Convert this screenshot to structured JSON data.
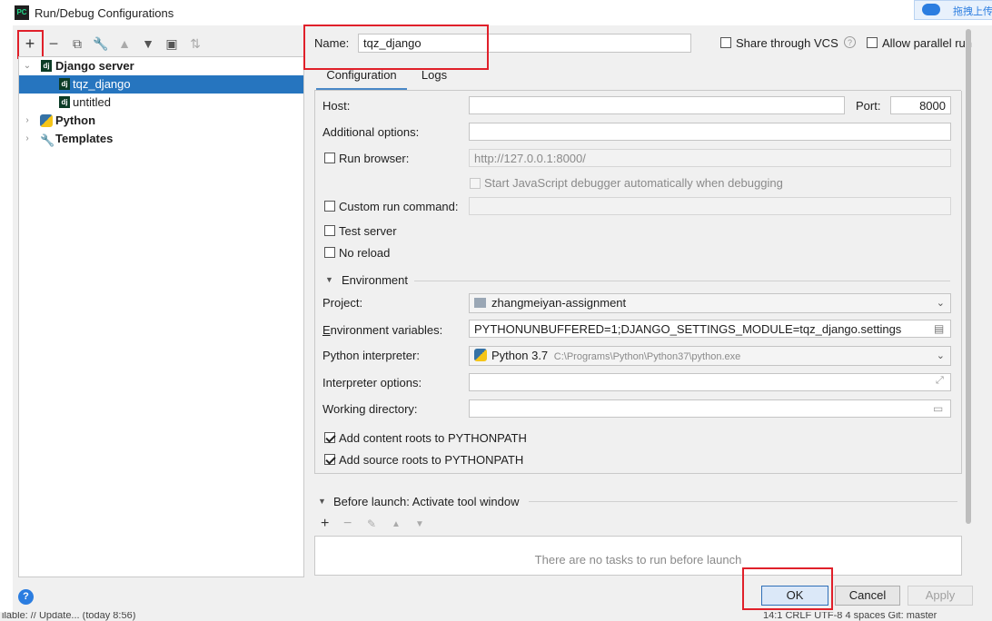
{
  "window": {
    "title": "Run/Debug Configurations",
    "app_icon": "PC",
    "baidu_widget": "拖拽上传"
  },
  "toolbar": {
    "icons": [
      "add-icon",
      "remove-icon",
      "copy-icon",
      "wrench-icon",
      "move-up-icon",
      "move-down-icon",
      "new-folder-icon",
      "sort-icon"
    ]
  },
  "tree": {
    "groups": [
      {
        "label": "Django server",
        "icon": "django-icon",
        "expanded": true,
        "children": [
          {
            "label": "tqz_django",
            "icon": "django-icon",
            "selected": true
          },
          {
            "label": "untitled",
            "icon": "django-icon",
            "selected": false
          }
        ]
      },
      {
        "label": "Python",
        "icon": "python-icon",
        "expanded": false
      },
      {
        "label": "Templates",
        "icon": "wrench-icon",
        "expanded": false
      }
    ]
  },
  "header": {
    "name_label": "Name:",
    "name_value": "tqz_django",
    "share_vcs": "Share through VCS",
    "share_vcs_checked": false,
    "allow_parallel": "Allow parallel run",
    "allow_parallel_checked": false
  },
  "tabs": [
    {
      "label": "Configuration",
      "active": true
    },
    {
      "label": "Logs",
      "active": false
    }
  ],
  "config": {
    "host_label": "Host:",
    "host_value": "",
    "port_label": "Port:",
    "port_value": "8000",
    "additional_options_label": "Additional options:",
    "additional_options_value": "",
    "run_browser_label": "Run browser:",
    "run_browser_checked": false,
    "run_browser_url": "http://127.0.0.1:8000/",
    "js_debugger_label": "Start JavaScript debugger automatically when debugging",
    "custom_run_label": "Custom run command:",
    "custom_run_checked": false,
    "test_server_label": "Test server",
    "test_server_checked": false,
    "no_reload_label": "No reload",
    "no_reload_checked": false,
    "environment_section": "Environment",
    "project_label": "Project:",
    "project_value": "zhangmeiyan-assignment",
    "env_vars_label": "Environment variables:",
    "env_vars_value": "PYTHONUNBUFFERED=1;DJANGO_SETTINGS_MODULE=tqz_django.settings",
    "interpreter_label": "Python interpreter:",
    "interpreter_name": "Python 3.7",
    "interpreter_path": "C:\\Programs\\Python\\Python37\\python.exe",
    "interpreter_options_label": "Interpreter options:",
    "interpreter_options_value": "",
    "working_dir_label": "Working directory:",
    "working_dir_value": "",
    "content_roots_label": "Add content roots to PYTHONPATH",
    "content_roots_checked": true,
    "source_roots_label": "Add source roots to PYTHONPATH",
    "source_roots_checked": true
  },
  "before_launch": {
    "title": "Before launch: Activate tool window",
    "icons": [
      "add-icon",
      "remove-icon",
      "edit-icon",
      "move-up-icon",
      "move-down-icon"
    ],
    "empty_text": "There are no tasks to run before launch"
  },
  "buttons": {
    "ok": "OK",
    "cancel": "Cancel",
    "apply": "Apply"
  },
  "status_bar": {
    "left": "ilable: // Update... (today 8:56)",
    "right": "14:1   CRLF   UTF-8   4 spaces   Git: master"
  },
  "annotation_color": "#e0202a",
  "selection_color": "#2675bf"
}
